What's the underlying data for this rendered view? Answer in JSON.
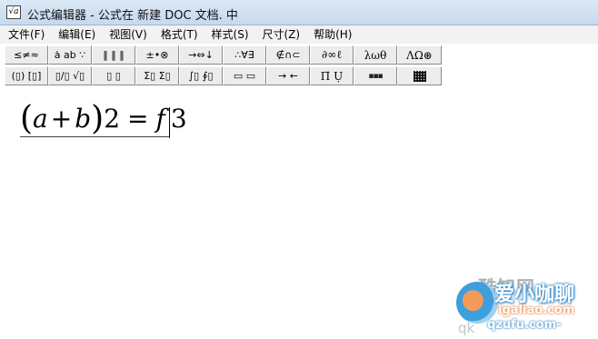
{
  "window": {
    "title": "公式编辑器 - 公式在 新建 DOC 文档. 中",
    "icon": "equation-editor-app-icon"
  },
  "menu": [
    {
      "label": "文件(F)"
    },
    {
      "label": "编辑(E)"
    },
    {
      "label": "视图(V)"
    },
    {
      "label": "格式(T)"
    },
    {
      "label": "样式(S)"
    },
    {
      "label": "尺寸(Z)"
    },
    {
      "label": "帮助(H)"
    }
  ],
  "toolbar_row1": [
    {
      "label": "≤≠≈",
      "name": "relational-symbols-palette",
      "icon": "relations-icon"
    },
    {
      "label": "ȧ ab ∵",
      "name": "spaces-ellipses-palette",
      "icon": "spaces-icon"
    },
    {
      "label": "‖ ‖ ‖",
      "name": "embellishments-palette",
      "icon": "embellishments-icon"
    },
    {
      "label": "±•⊗",
      "name": "operator-symbols-palette",
      "icon": "operators-icon"
    },
    {
      "label": "→⇔↓",
      "name": "arrow-symbols-palette",
      "icon": "arrows-icon"
    },
    {
      "label": "∴∀∃",
      "name": "logical-symbols-palette",
      "icon": "logic-icon"
    },
    {
      "label": "∉∩⊂",
      "name": "set-theory-palette",
      "icon": "sets-icon"
    },
    {
      "label": "∂∞ℓ",
      "name": "misc-symbols-palette",
      "icon": "misc-symbols-icon"
    },
    {
      "label": "λωθ",
      "name": "greek-lowercase-palette",
      "icon": "greek-lower-icon"
    },
    {
      "label": "ΛΩ⊛",
      "name": "greek-uppercase-palette",
      "icon": "greek-upper-icon"
    }
  ],
  "toolbar_row2": [
    {
      "label": "(▯) [▯]",
      "name": "fence-templates-palette",
      "icon": "fences-icon"
    },
    {
      "label": "▯/▯ √▯",
      "name": "fraction-radical-palette",
      "icon": "fraction-radical-icon"
    },
    {
      "label": "▯ ▯",
      "name": "subscript-superscript-palette",
      "icon": "scripts-icon"
    },
    {
      "label": "Σ▯ Σ▯",
      "name": "summation-palette",
      "icon": "summation-icon"
    },
    {
      "label": "∫▯ ∮▯",
      "name": "integral-palette",
      "icon": "integral-icon"
    },
    {
      "label": "▭ ▭",
      "name": "underbar-overbar-palette",
      "icon": "bars-icon"
    },
    {
      "label": "→ ←",
      "name": "labeled-arrow-palette",
      "icon": "labeled-arrows-icon"
    },
    {
      "label": "Π̈ Ụ",
      "name": "products-set-palette",
      "icon": "products-icon"
    },
    {
      "label": "▪▪▪",
      "name": "matrix-row-palette",
      "icon": "matrix-row-icon"
    },
    {
      "label": "",
      "name": "matrix-grid-palette",
      "icon": "matrix-grid-icon"
    }
  ],
  "equation": {
    "open_paren": "(",
    "a": "a",
    "plus": "+",
    "b": "b",
    "close_paren": ")",
    "two": "2",
    "equals": "=",
    "f": "f",
    "three": "3"
  },
  "watermark": {
    "top": "酷知网",
    "main": "爱小咖聊",
    "url": "igaliao.com",
    "url2_left": "qk",
    "url2": "qzufu.com-"
  }
}
